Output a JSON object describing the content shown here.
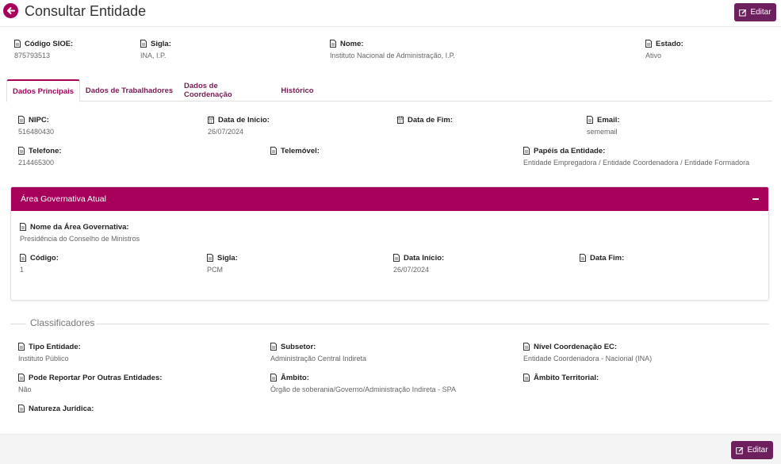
{
  "header": {
    "title": "Consultar Entidade",
    "edit_label": "Editar"
  },
  "summary": {
    "codigo": {
      "label": "Código SIOE:",
      "value": "875793513"
    },
    "sigla": {
      "label": "Sigla:",
      "value": "INA, I.P."
    },
    "nome": {
      "label": "Nome:",
      "value": "Instituto Nacional de Administração, I.P."
    },
    "estado": {
      "label": "Estado:",
      "value": "Ativo"
    }
  },
  "tabs": [
    {
      "label": "Dados Principais",
      "active": true
    },
    {
      "label": "Dados de Trabalhadores",
      "active": false
    },
    {
      "label": "Dados de Coordenação",
      "active": false
    },
    {
      "label": "Histórico",
      "active": false
    }
  ],
  "principal": {
    "nipc": {
      "label": "NIPC:",
      "value": "516480430"
    },
    "data_inicio": {
      "label": "Data de Início:",
      "value": "26/07/2024"
    },
    "data_fim": {
      "label": "Data de Fim:",
      "value": ""
    },
    "email": {
      "label": "Email:",
      "value": "sememail"
    },
    "telefone": {
      "label": "Telefone:",
      "value": "214465300"
    },
    "telemovel": {
      "label": "Telemóvel:",
      "value": ""
    },
    "papeis": {
      "label": "Papéis da Entidade:",
      "value": "Entidade Empregadora / Entidade Coordenadora / Entidade Formadora"
    }
  },
  "area": {
    "title": "Área Governativa Atual",
    "nome": {
      "label": "Nome da Área Governativa:",
      "value": "Presidência do Conselho de Ministros"
    },
    "codigo": {
      "label": "Código:",
      "value": "1"
    },
    "sigla": {
      "label": "Sigla:",
      "value": "PCM"
    },
    "data_inicio": {
      "label": "Data Início:",
      "value": "26/07/2024"
    },
    "data_fim": {
      "label": "Data Fim:",
      "value": ""
    }
  },
  "classificadores": {
    "title": "Classificadores",
    "tipo": {
      "label": "Tipo Entidade:",
      "value": "Instituto Público"
    },
    "subsetor": {
      "label": "Subsetor:",
      "value": "Administração Central Indireta"
    },
    "nivel": {
      "label": "Nível Coordenação EC:",
      "value": "Entidade Coordenadora - Nacional (INA)"
    },
    "reportar": {
      "label": "Pode Reportar Por Outras Entidades:",
      "value": "Não"
    },
    "ambito": {
      "label": "Âmbito:",
      "value": "Órgão de soberania/Governo/Administração Indireta - SPA"
    },
    "ambito_territorial": {
      "label": "Âmbito Territorial:",
      "value": ""
    },
    "natureza": {
      "label": "Natureza Jurídica:",
      "value": ""
    }
  },
  "colors": {
    "accent": "#a6005a",
    "button": "#6d1f5e"
  }
}
